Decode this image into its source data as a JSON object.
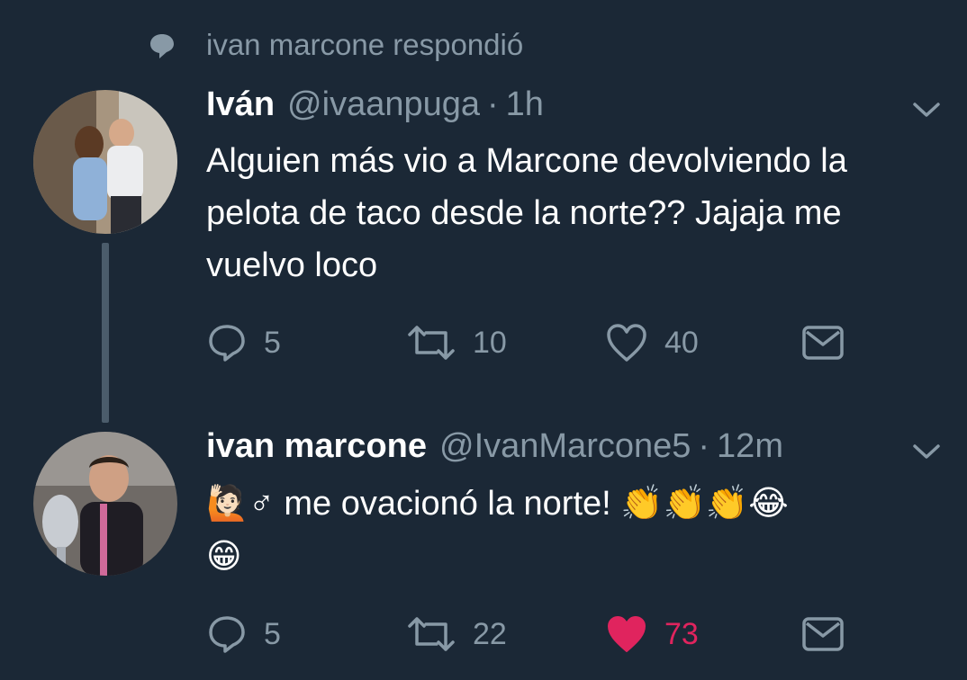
{
  "reply_context": {
    "text": "ivan marcone respondió"
  },
  "tweets": [
    {
      "name": "Iván",
      "handle": "@ivaanpuga",
      "separator": "·",
      "time": "1h",
      "text": "Alguien más vio a Marcone devolviendo la pelota de taco desde la norte?? Jajaja me vuelvo loco",
      "actions": {
        "replies": "5",
        "retweets": "10",
        "likes": "40",
        "liked": false
      }
    },
    {
      "name": "ivan marcone",
      "handle": "@IvanMarcone5",
      "separator": "·",
      "time": "12m",
      "text_emoji_prefix": "🙋🏻",
      "text_main": "♂ me ovacionó la norte! ",
      "text_emoji_suffix": "👏👏👏😂",
      "text_line2": "😁",
      "actions": {
        "replies": "5",
        "retweets": "22",
        "likes": "73",
        "liked": true
      }
    }
  ],
  "colors": {
    "background": "#1b2836",
    "secondary_text": "#8899a6",
    "like_active": "#e0245e",
    "thread_line": "#4b5c6b"
  },
  "icons": [
    "speech-bubble-icon",
    "reply-icon",
    "retweet-icon",
    "heart-icon",
    "heart-filled-icon",
    "envelope-icon",
    "chevron-down-icon"
  ]
}
